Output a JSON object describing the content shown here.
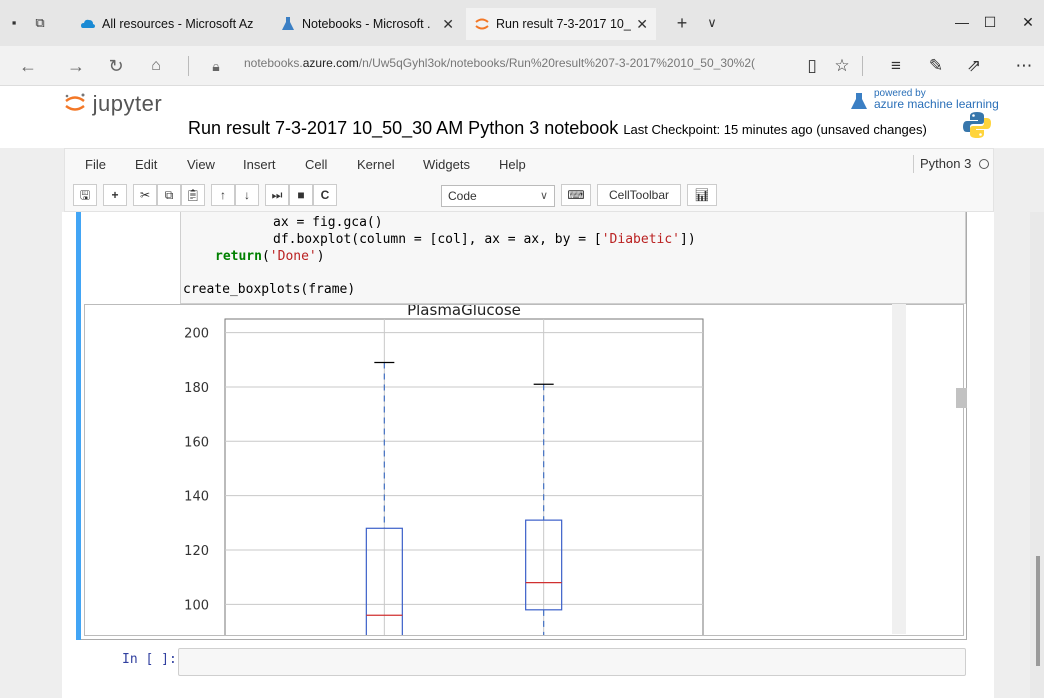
{
  "browser": {
    "tabs": [
      {
        "title": "All resources - Microsoft Az"
      },
      {
        "title": "Notebooks - Microsoft ."
      },
      {
        "title": "Run result 7-3-2017 10_"
      }
    ],
    "new_tab": "+",
    "tab_menu": "∨",
    "url_prefix": "notebooks.",
    "url_domain": "azure.com",
    "url_path": "/n/Uw5qGyhl3ok/notebooks/Run%20result%207-3-2017%2010_50_30%2("
  },
  "jupyter": {
    "logo_text": "jupyter",
    "powered_by": "powered by",
    "powered_service": "azure machine learning",
    "notebook_title": "Run result 7-3-2017 10_50_30 AM Python 3 notebook",
    "checkpoint": "Last Checkpoint: 15 minutes ago (unsaved changes)",
    "menu": [
      "File",
      "Edit",
      "View",
      "Insert",
      "Cell",
      "Kernel",
      "Widgets",
      "Help"
    ],
    "kernel_name": "Python 3",
    "cell_type": "Code",
    "celltoolbar_label": "CellToolbar"
  },
  "code": {
    "line1": "ax = fig.gca()",
    "line2_a": "df.boxplot(column = [col], ax = ax, by = [",
    "line2_str": "'Diabetic'",
    "line2_b": "])",
    "line3_kw": "return",
    "line3_a": "(",
    "line3_str": "'Done'",
    "line3_b": ")",
    "line4": "create_boxplots(frame)"
  },
  "next_cell_prompt": "In [ ]:",
  "chart_data": {
    "type": "box",
    "title": "PlasmaGlucose",
    "ylim": [
      88,
      205
    ],
    "yticks": [
      100,
      120,
      140,
      160,
      180,
      200
    ],
    "grid": true,
    "boxes": [
      {
        "whisker_high": 189,
        "q3": 128,
        "median": 96,
        "q1": null,
        "whisker_low": null
      },
      {
        "whisker_high": 181,
        "q3": 131,
        "median": 108,
        "q1": 98,
        "whisker_low": null
      }
    ]
  }
}
